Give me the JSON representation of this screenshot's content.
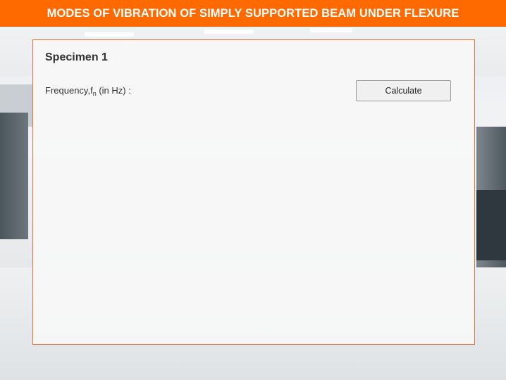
{
  "header": {
    "title": "MODES OF VIBRATION OF SIMPLY SUPPORTED BEAM UNDER FLEXURE",
    "background_color": "#ff6a00"
  },
  "panel": {
    "title": "Specimen 1",
    "border_color": "#e8733a",
    "frequency_label": {
      "prefix": "Frequency,f",
      "subscript": "n",
      "suffix": " (in Hz) :"
    },
    "calculate_button_label": "Calculate"
  }
}
